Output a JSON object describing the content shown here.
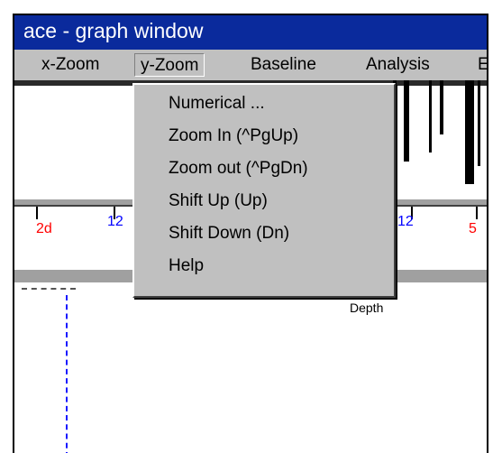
{
  "window": {
    "title": "ace - graph window"
  },
  "menubar": {
    "items": [
      {
        "label": "x-Zoom"
      },
      {
        "label": "y-Zoom"
      },
      {
        "label": "Baseline"
      },
      {
        "label": "Analysis"
      },
      {
        "label": "E"
      }
    ]
  },
  "dropdown": {
    "items": [
      {
        "label": "Numerical ..."
      },
      {
        "label": "Zoom In (^PgUp)"
      },
      {
        "label": "Zoom out (^PgDn)"
      },
      {
        "label": "Shift Up (Up)"
      },
      {
        "label": "Shift Down (Dn)"
      },
      {
        "label": "Help"
      }
    ]
  },
  "axis": {
    "labels": [
      {
        "text": "2d",
        "color": "#ff0000"
      },
      {
        "text": "12",
        "color": "#0000ff"
      },
      {
        "text": "12",
        "color": "#0000ff"
      },
      {
        "text": "5",
        "color": "#ff0000"
      }
    ]
  },
  "plot": {
    "depth_label": "Depth"
  },
  "colors": {
    "title_bar": "#0a2a9c",
    "menu_bg": "#c0c0c0",
    "trace_dashed": "#1a1aff"
  }
}
